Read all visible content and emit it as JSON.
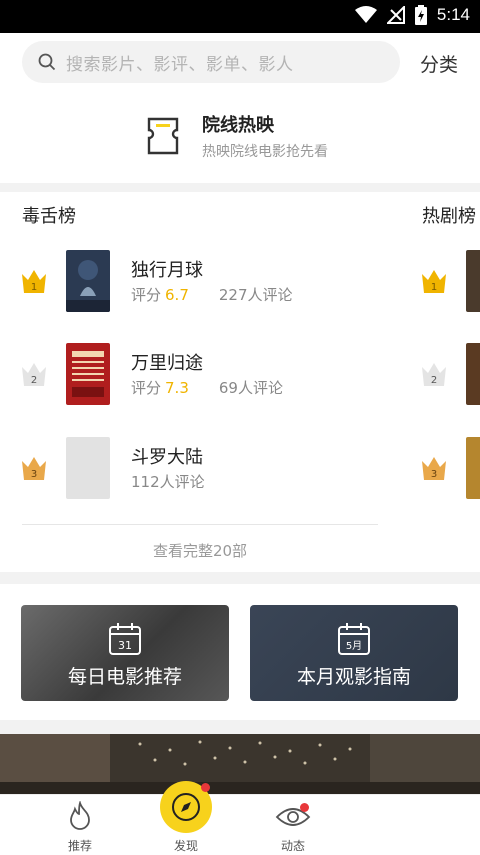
{
  "status": {
    "time": "5:14"
  },
  "search": {
    "placeholder": "搜索影片、影评、影单、影人"
  },
  "header": {
    "category_label": "分类"
  },
  "cinema": {
    "title": "院线热映",
    "subtitle": "热映院线电影抢先看"
  },
  "ranks": [
    {
      "title": "毒舌榜",
      "items": [
        {
          "rank": "1",
          "name": "独行月球",
          "score_label": "评分",
          "score": "6.7",
          "comments": "227人评论"
        },
        {
          "rank": "2",
          "name": "万里归途",
          "score_label": "评分",
          "score": "7.3",
          "comments": "69人评论"
        },
        {
          "rank": "3",
          "name": "斗罗大陆",
          "score_label": "",
          "score": "",
          "comments": "112人评论"
        }
      ],
      "view_all": "查看完整20部"
    },
    {
      "title": "热剧榜",
      "items": [
        {
          "rank": "1"
        },
        {
          "rank": "2"
        },
        {
          "rank": "3"
        }
      ]
    }
  ],
  "guides": [
    {
      "label": "每日电影推荐",
      "icon_number": "31"
    },
    {
      "label": "本月观影指南",
      "icon_number": "5月"
    }
  ],
  "tabs": [
    {
      "label": "推荐",
      "icon": "flame-icon"
    },
    {
      "label": "发现",
      "icon": "compass-icon"
    },
    {
      "label": "动态",
      "icon": "eye-icon"
    }
  ],
  "colors": {
    "accent": "#f7d21c",
    "score": "#f0b400",
    "badge": "#e8373a"
  }
}
